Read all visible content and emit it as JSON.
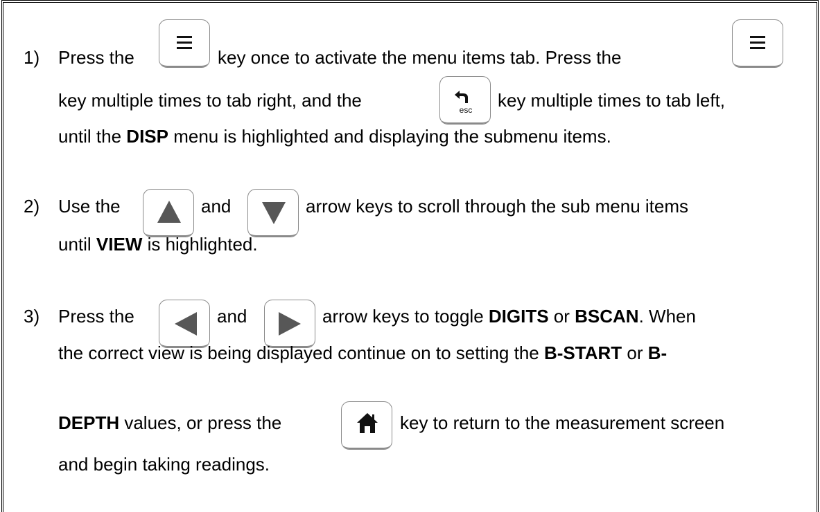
{
  "steps": [
    {
      "number": "1)",
      "line1_a": "Press the",
      "line1_b": "key once to activate the menu items tab.  Press the",
      "line2_a": "key multiple times to tab right, and the",
      "line2_b": "key multiple times to tab left,",
      "line3_a": "until the ",
      "line3_b": "DISP",
      "line3_c": " menu is highlighted and displaying the submenu items."
    },
    {
      "number": "2)",
      "line1_a": "Use the",
      "line1_b": "and",
      "line1_c": "arrow keys to scroll through the sub menu items",
      "line2_a": "until ",
      "line2_b": "VIEW",
      "line2_c": " is highlighted."
    },
    {
      "number": "3)",
      "line1_a": "Press the",
      "line1_b": "and",
      "line1_c": "arrow keys to toggle ",
      "line1_d": "DIGITS",
      "line1_e": " or ",
      "line1_f": "BSCAN",
      "line1_g": ".  When",
      "line2_a": "the correct view is being displayed continue on to setting the ",
      "line2_b": "B-START",
      "line2_c": " or ",
      "line2_d": "B-",
      "line3_a": "DEPTH",
      "line3_b": " values, or press the",
      "line3_c": "key to return to the measurement screen",
      "line4_a": "and begin taking readings."
    }
  ],
  "keys": {
    "esc_label": "esc"
  },
  "icons": [
    "menu-icon",
    "back-arrow-icon",
    "up-arrow-icon",
    "down-arrow-icon",
    "left-arrow-icon",
    "right-arrow-icon",
    "home-icon"
  ]
}
